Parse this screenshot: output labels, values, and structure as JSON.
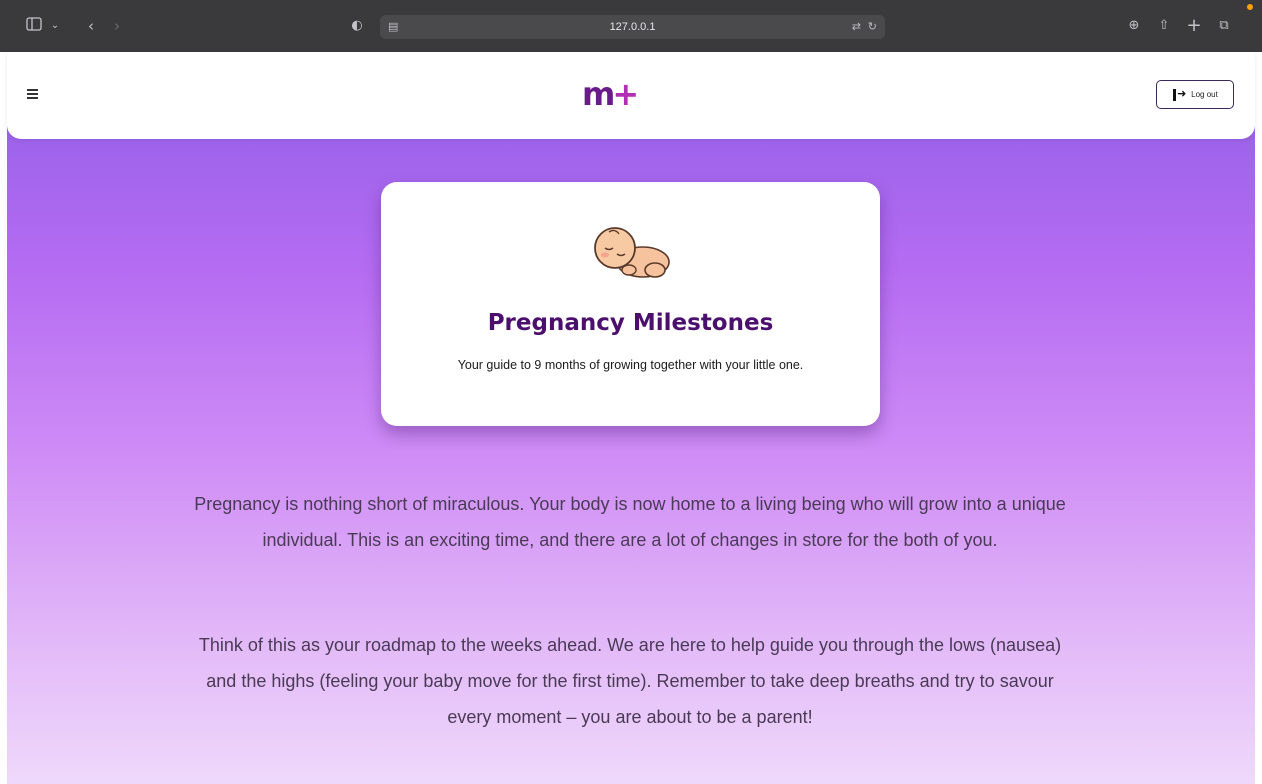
{
  "browser": {
    "address": "127.0.0.1",
    "icons": [
      "sidebar-icon",
      "chevron-down-icon",
      "back-icon",
      "forward-icon",
      "shield-icon",
      "page-icon",
      "translate-icon",
      "reload-icon",
      "download-icon",
      "share-icon",
      "new-tab-icon",
      "tabs-icon"
    ]
  },
  "header": {
    "logo_text": "m",
    "logo_plus": "+",
    "logout_label": "Log out"
  },
  "hero": {
    "title": "Pregnancy Milestones",
    "subtitle": "Your guide to 9 months of growing together with your little one."
  },
  "intro": {
    "paragraph_1": "Pregnancy is nothing short of miraculous. Your body is now home to a living being who will grow into a unique individual. This is an exciting time, and there are a lot of changes in store for the both of you.",
    "paragraph_2": "Think of this as your roadmap to the weeks ahead. We are here to help guide you through the lows (nausea) and the highs (feeling your baby move for the first time). Remember to take deep breaths and try to savour every moment – you are about to be a parent!"
  },
  "colors": {
    "brand_dark": "#4b0f6e",
    "brand_accent": "#b02fb5",
    "gradient_top": "#8f5ee6",
    "gradient_bottom": "#efd9fb"
  }
}
